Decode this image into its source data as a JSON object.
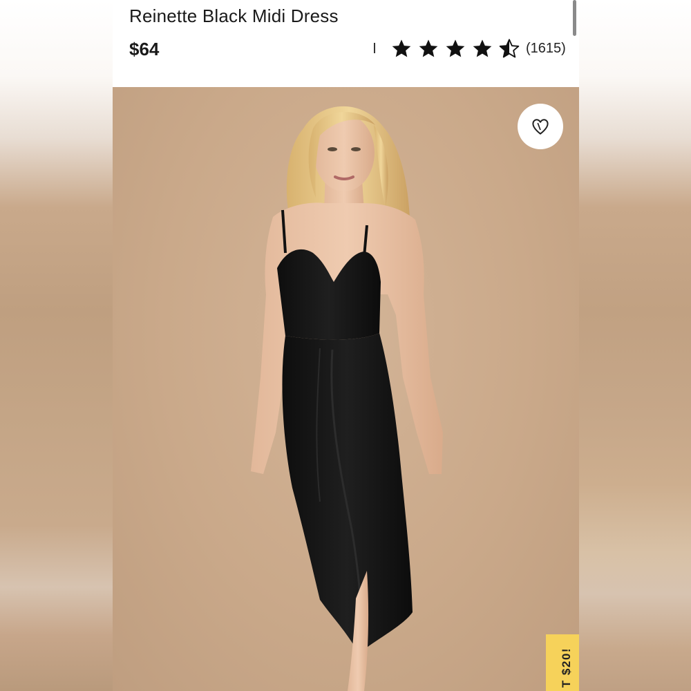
{
  "product": {
    "title": "Reinette Black Midi Dress",
    "price": "$64",
    "rating": {
      "value": 4.5,
      "max": 5,
      "count_text": "(1615)",
      "star_icons": [
        "star-filled",
        "star-filled",
        "star-filled",
        "star-filled",
        "star-half"
      ]
    }
  },
  "favorite": {
    "icon": "heart-outline-icon"
  },
  "promo": {
    "label": "T $20!",
    "background": "#f6d25a"
  },
  "colors": {
    "header_bg": "#ffffff",
    "text": "#1a1a1a",
    "photo_bg": "#c9a98b",
    "dress": "#141414"
  }
}
